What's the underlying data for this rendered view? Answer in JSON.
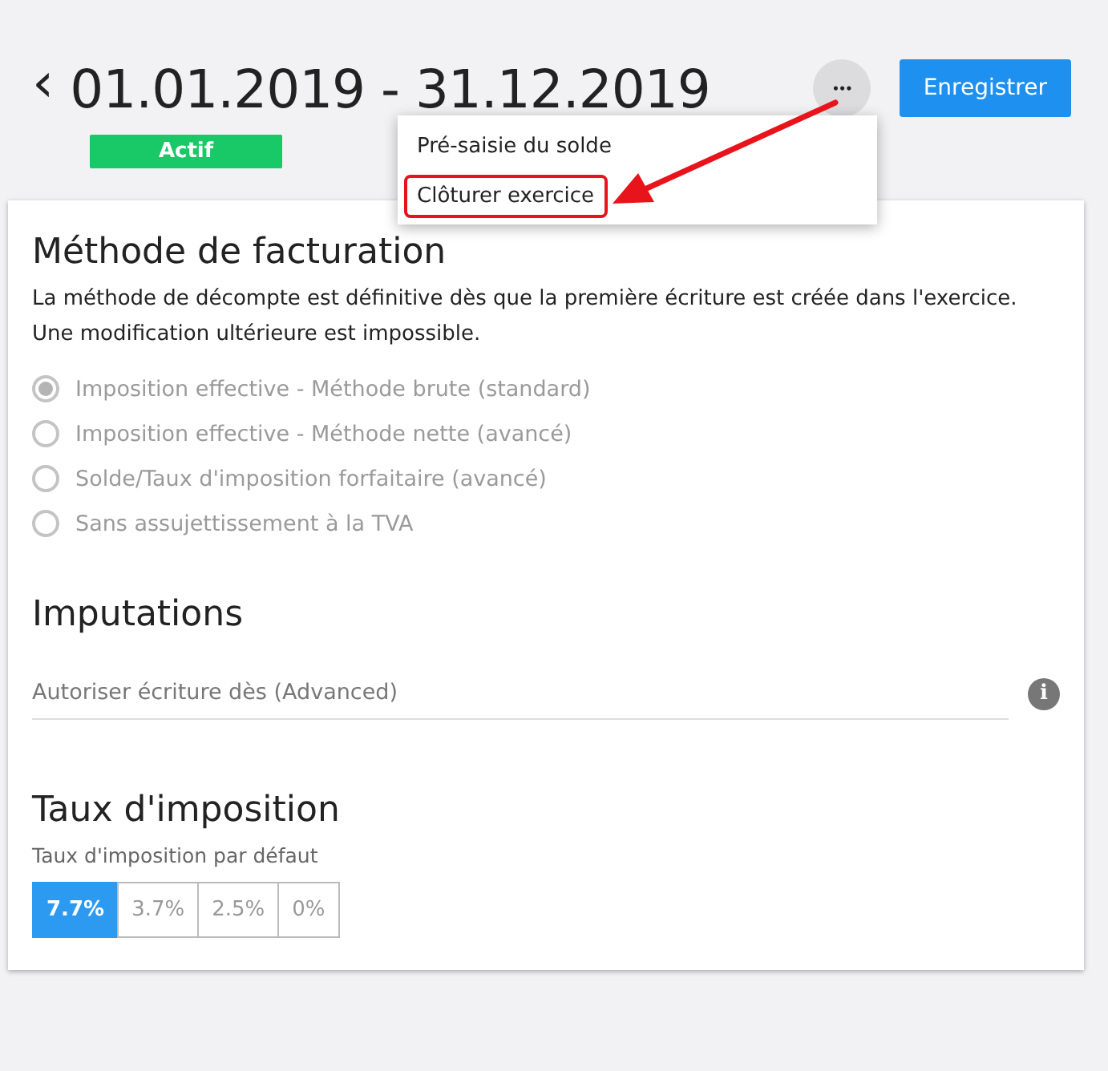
{
  "header": {
    "back": "‹",
    "title": "01.01.2019 - 31.12.2019",
    "status": "Actif",
    "more": "•••",
    "save": "Enregistrer"
  },
  "menu": {
    "open": true,
    "items": [
      {
        "label": "Pré-saisie du solde",
        "highlighted": false
      },
      {
        "label": "Clôturer exercice",
        "highlighted": true
      }
    ]
  },
  "annotation": {
    "kind": "arrow"
  },
  "billing": {
    "title": "Méthode de facturation",
    "description": "La méthode de décompte est définitive dès que la première écriture est créée dans l'exercice. Une modification ultérieure est impossible.",
    "disabled": true,
    "options": [
      {
        "label": "Imposition effective - Méthode brute (standard)",
        "selected": true
      },
      {
        "label": "Imposition effective - Méthode nette (avancé)",
        "selected": false
      },
      {
        "label": "Solde/Taux d'imposition forfaitaire (avancé)",
        "selected": false
      },
      {
        "label": "Sans assujettissement à la TVA",
        "selected": false
      }
    ]
  },
  "imputations": {
    "title": "Imputations",
    "field": {
      "placeholder": "Autoriser écriture dès (Advanced)"
    },
    "info": "i"
  },
  "tax": {
    "title": "Taux d'imposition",
    "label": "Taux d'imposition par défaut",
    "rates": [
      {
        "label": "7.7%",
        "selected": true
      },
      {
        "label": "3.7%",
        "selected": false
      },
      {
        "label": "2.5%",
        "selected": false
      },
      {
        "label": "0%",
        "selected": false
      }
    ]
  }
}
